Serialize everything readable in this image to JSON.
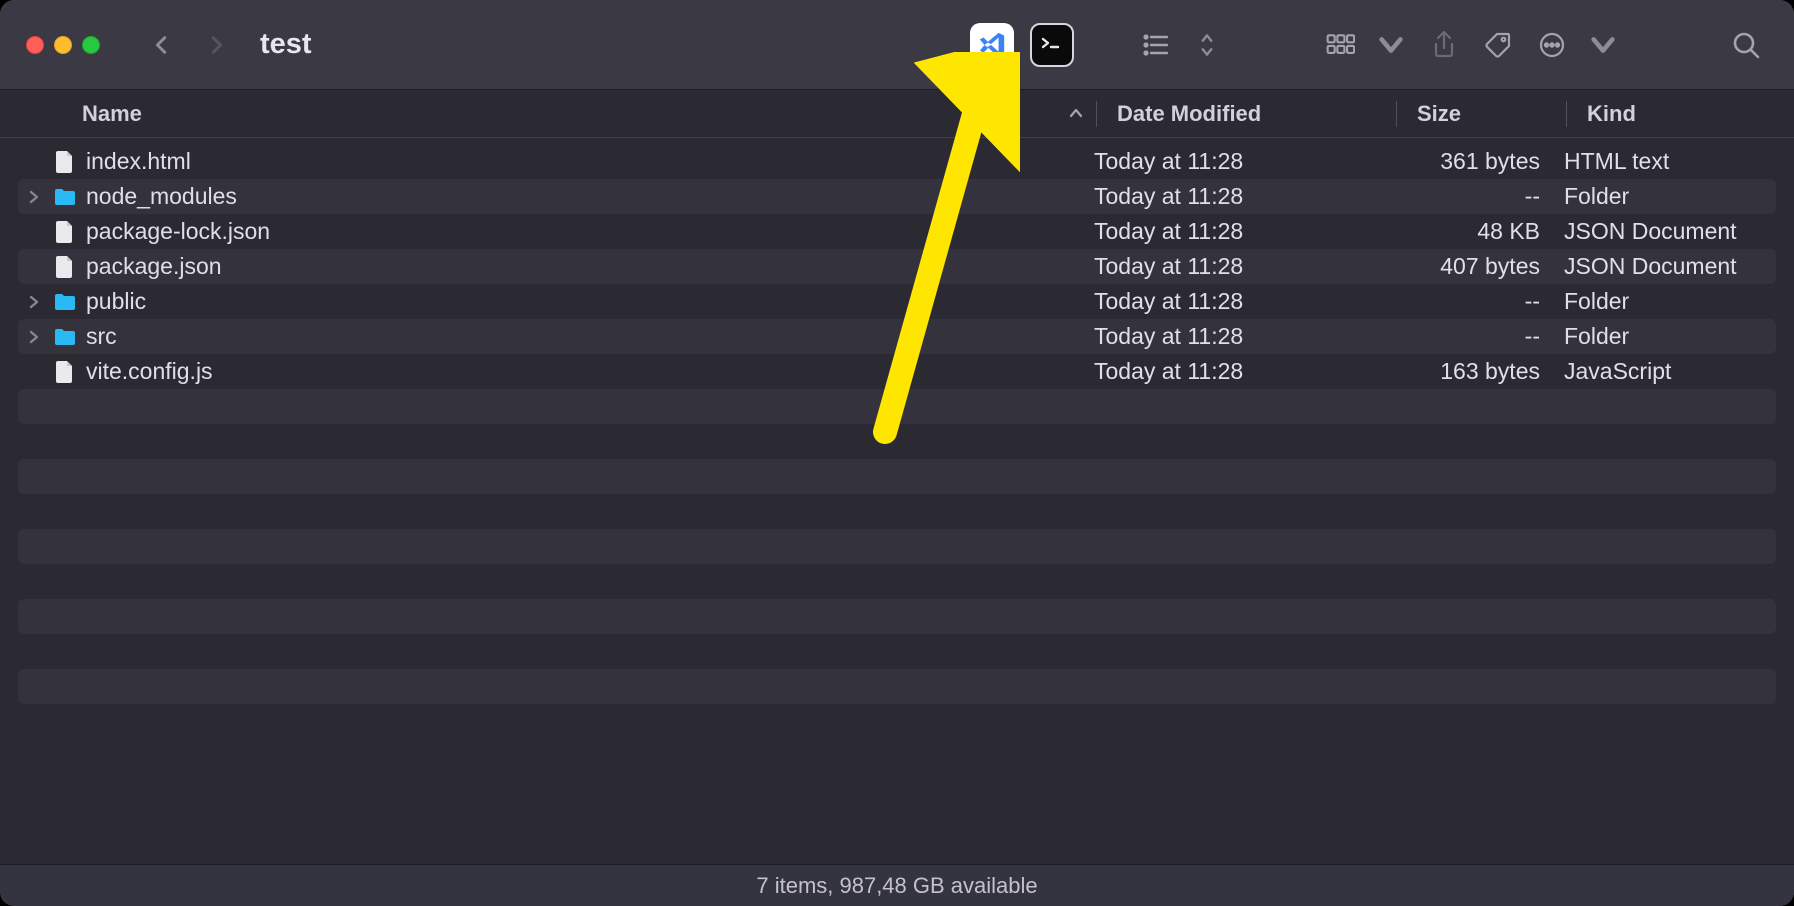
{
  "window": {
    "title": "test"
  },
  "columns": {
    "name": "Name",
    "modified": "Date Modified",
    "size": "Size",
    "kind": "Kind"
  },
  "toolbar_icons": {
    "vscode": "vscode-icon",
    "terminal": "terminal-icon",
    "list_view": "list-view-icon",
    "groups": "groups-icon",
    "share": "share-icon",
    "tags": "tags-icon",
    "more": "more-icon",
    "search": "search-icon"
  },
  "items": [
    {
      "name": "index.html",
      "modified": "Today at 11:28",
      "size": "361 bytes",
      "kind": "HTML text",
      "type": "file",
      "expandable": false
    },
    {
      "name": "node_modules",
      "modified": "Today at 11:28",
      "size": "--",
      "kind": "Folder",
      "type": "folder",
      "expandable": true
    },
    {
      "name": "package-lock.json",
      "modified": "Today at 11:28",
      "size": "48 KB",
      "kind": "JSON Document",
      "type": "file",
      "expandable": false
    },
    {
      "name": "package.json",
      "modified": "Today at 11:28",
      "size": "407 bytes",
      "kind": "JSON Document",
      "type": "file",
      "expandable": false
    },
    {
      "name": "public",
      "modified": "Today at 11:28",
      "size": "--",
      "kind": "Folder",
      "type": "folder",
      "expandable": true
    },
    {
      "name": "src",
      "modified": "Today at 11:28",
      "size": "--",
      "kind": "Folder",
      "type": "folder",
      "expandable": true
    },
    {
      "name": "vite.config.js",
      "modified": "Today at 11:28",
      "size": "163 bytes",
      "kind": "JavaScript",
      "type": "file",
      "expandable": false
    }
  ],
  "status": "7 items, 987,48 GB available",
  "empty_row_count": 9
}
